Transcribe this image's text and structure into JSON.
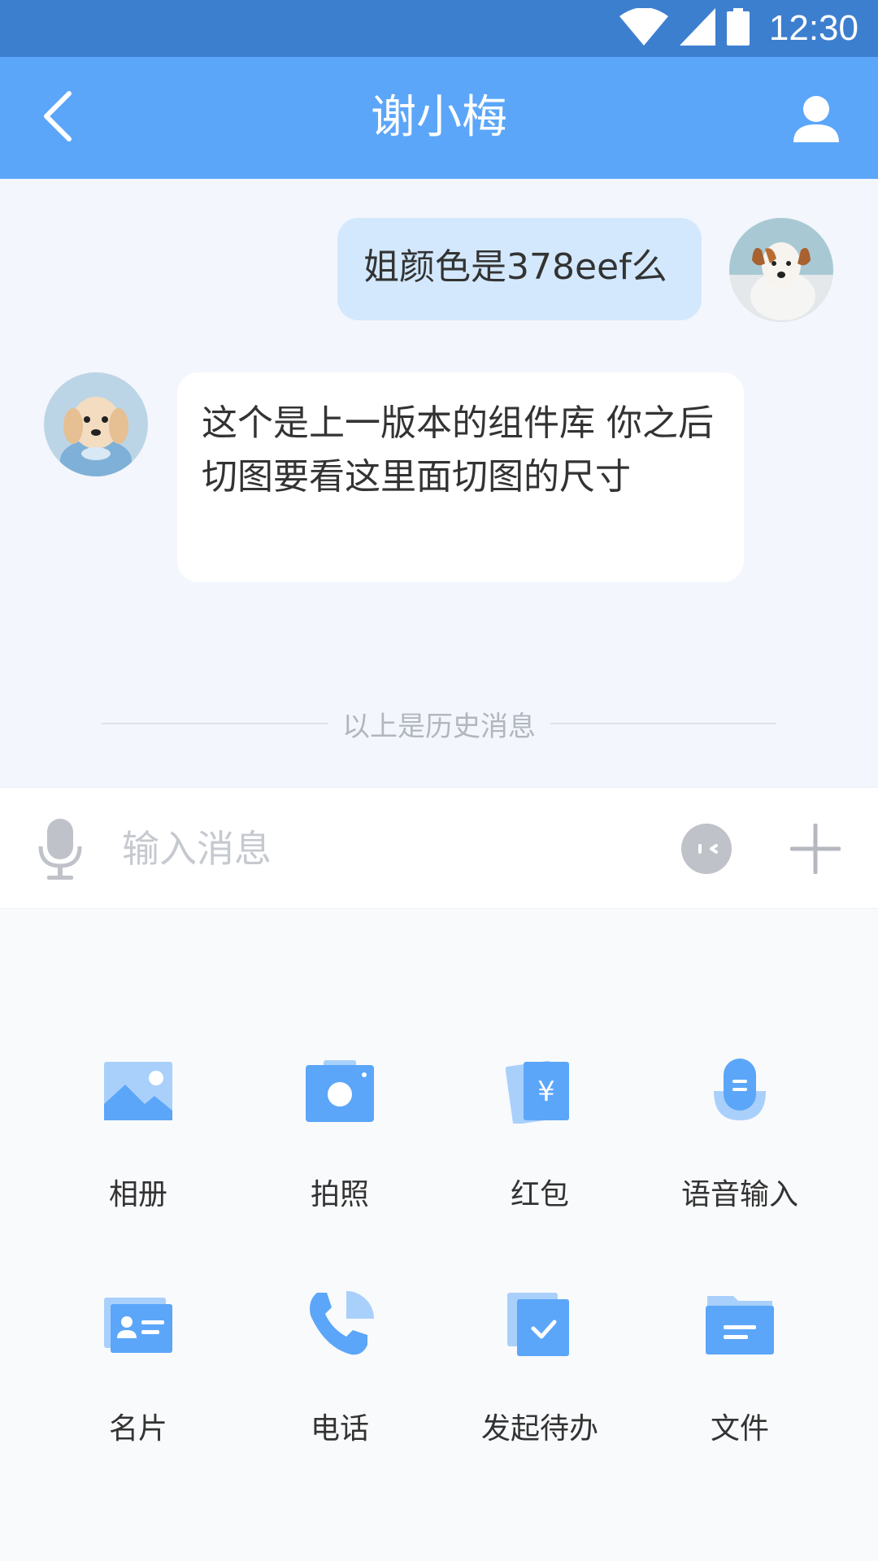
{
  "status_bar": {
    "time": "12:30",
    "icons": [
      "wifi-icon",
      "signal-icon",
      "battery-icon"
    ]
  },
  "nav": {
    "title": "谢小梅",
    "back_icon": "chevron-left-icon",
    "profile_icon": "user-icon"
  },
  "messages": [
    {
      "direction": "outgoing",
      "text": "姐颜色是378eef么"
    },
    {
      "direction": "incoming",
      "text": "这个是上一版本的组件库 你之后切图要看这里面切图的尺寸"
    }
  ],
  "history_divider": "以上是历史消息",
  "input": {
    "placeholder": "输入消息",
    "value": ""
  },
  "actions": [
    {
      "label": "相册",
      "icon": "album-icon"
    },
    {
      "label": "拍照",
      "icon": "camera-icon"
    },
    {
      "label": "红包",
      "icon": "red-envelope-icon"
    },
    {
      "label": "语音输入",
      "icon": "voice-input-icon"
    },
    {
      "label": "名片",
      "icon": "business-card-icon"
    },
    {
      "label": "电话",
      "icon": "phone-icon"
    },
    {
      "label": "发起待办",
      "icon": "todo-icon"
    },
    {
      "label": "文件",
      "icon": "file-icon"
    }
  ],
  "colors": {
    "status_bar": "#3d7fcf",
    "nav_bar": "#5ba6f9",
    "accent": "#5ba6f9",
    "accent_light": "#a9d0fb",
    "outgoing_bubble": "#d3e8fd",
    "incoming_bubble": "#ffffff",
    "chat_background": "#f3f6fc"
  }
}
